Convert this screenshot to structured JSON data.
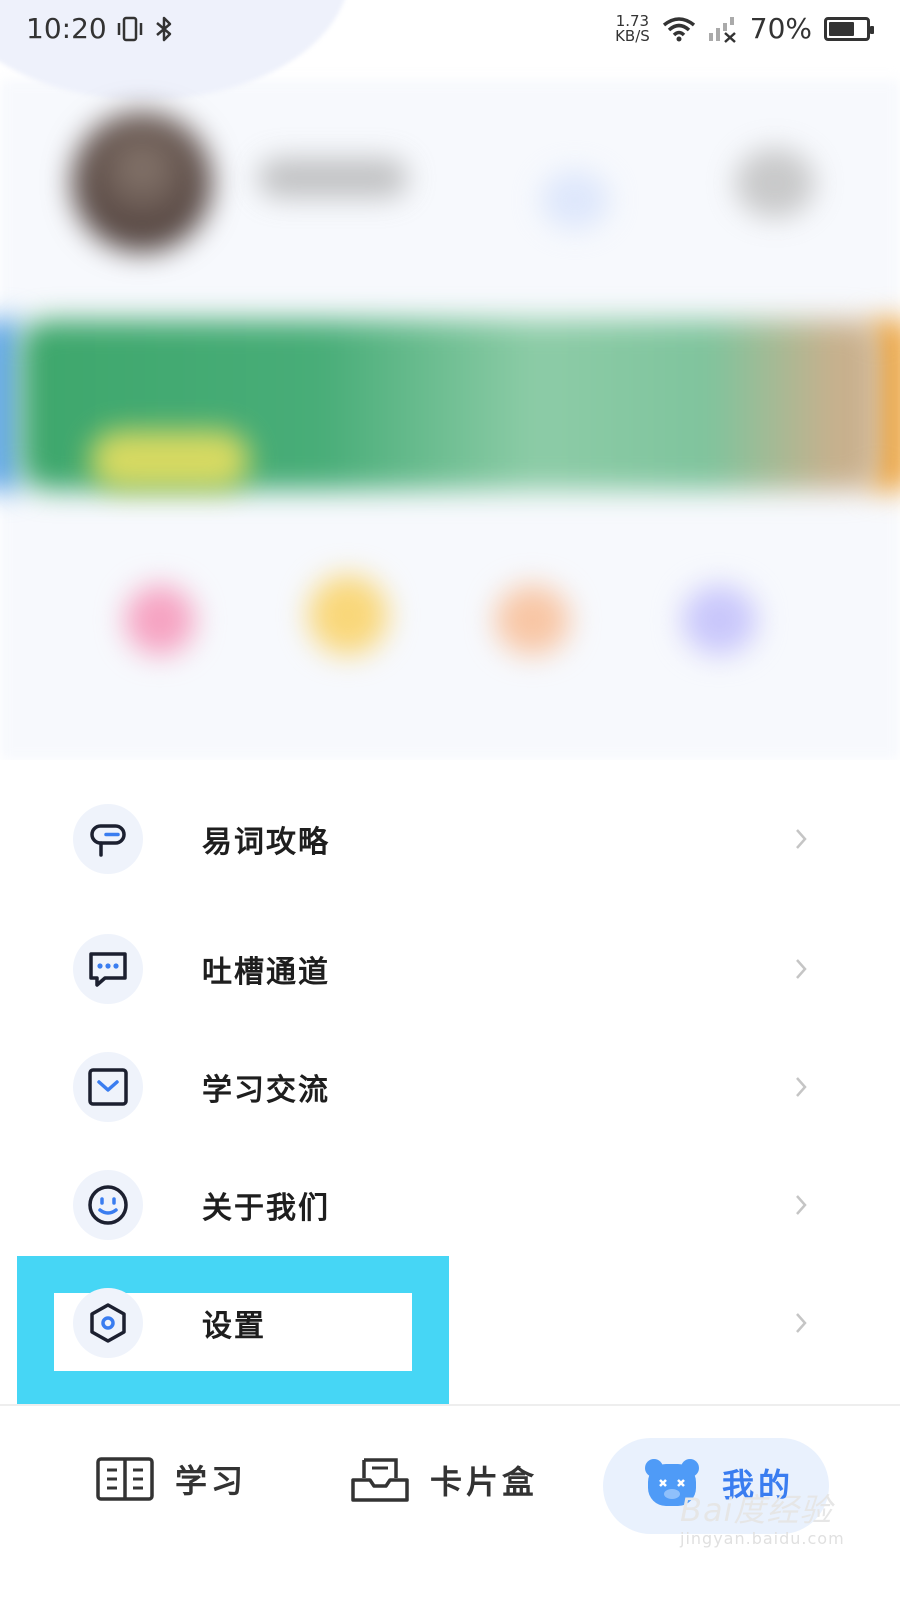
{
  "status_bar": {
    "time": "10:20",
    "net_speed": "1.73",
    "net_unit": "KB/S",
    "battery": "70%",
    "battery_level": 0.7
  },
  "menu": {
    "items": [
      {
        "label": "易词攻略",
        "icon": "signpost-icon"
      },
      {
        "label": "吐槽通道",
        "icon": "chat-bubble-icon"
      },
      {
        "label": "学习交流",
        "icon": "mail-icon"
      },
      {
        "label": "关于我们",
        "icon": "smiley-icon"
      },
      {
        "label": "设置",
        "icon": "settings-hexagon-icon"
      }
    ]
  },
  "bottom_nav": {
    "items": [
      {
        "label": "学习",
        "icon": "book-grid-icon",
        "active": false
      },
      {
        "label": "卡片盒",
        "icon": "card-box-icon",
        "active": false
      },
      {
        "label": "我的",
        "icon": "bear-avatar-icon",
        "active": true
      }
    ]
  },
  "watermark": {
    "brand": "Bai度经验",
    "url": "jingyan.baidu.com"
  },
  "colors": {
    "accent": "#3a7df0",
    "highlight": "#46d6f5",
    "icon_dark": "#1c2030"
  }
}
